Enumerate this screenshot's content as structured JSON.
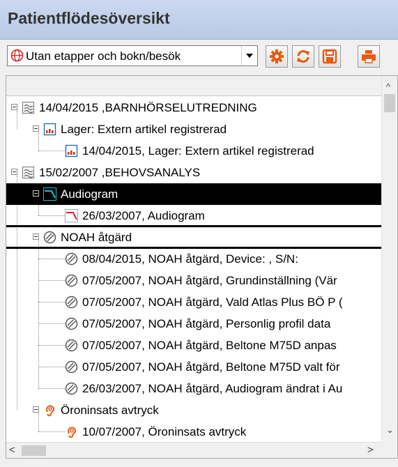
{
  "window": {
    "title": "Patientflödesöversikt"
  },
  "filter": {
    "selected": "Utan etapper och bokn/besök"
  },
  "toolbar": {
    "buttons": [
      {
        "name": "settings-button",
        "icon": "gear-icon",
        "color": "#e85a12"
      },
      {
        "name": "refresh-button",
        "icon": "refresh-icon",
        "color": "#e85a12"
      },
      {
        "name": "save-button",
        "icon": "save-icon",
        "color": "#e85a12"
      },
      {
        "name": "print-button",
        "icon": "print-icon",
        "color": "#e85a12"
      }
    ]
  },
  "tree": {
    "rows": [
      {
        "label": "14/04/2015 ,BARNHÖRSELUTREDNING",
        "icon": "referral-icon",
        "level": 0,
        "expander": true
      },
      {
        "label": "Lager: Extern artikel registrerad",
        "icon": "inventory-icon",
        "level": 1,
        "expander": true
      },
      {
        "label": "14/04/2015, Lager: Extern artikel registrerad",
        "icon": "inventory-icon",
        "level": 2,
        "expander": false
      },
      {
        "label": "15/02/2007 ,BEHOVSANALYS",
        "icon": "referral-icon",
        "level": 0,
        "expander": true
      },
      {
        "label": "Audiogram",
        "icon": "audiogram-icon",
        "level": 1,
        "expander": true,
        "selected": true
      },
      {
        "label": "26/03/2007, Audiogram",
        "icon": "audiogram-icon",
        "level": 2,
        "expander": false
      },
      {
        "label": "NOAH åtgärd",
        "icon": "noah-icon",
        "level": 1,
        "expander": true
      },
      {
        "label": "08/04/2015, NOAH åtgärd, Device: , S/N:",
        "icon": "noah-icon",
        "level": 2,
        "expander": false
      },
      {
        "label": "07/05/2007, NOAH åtgärd, Grundinställning (Vär",
        "icon": "noah-icon",
        "level": 2,
        "expander": false
      },
      {
        "label": "07/05/2007, NOAH åtgärd, Vald Atlas Plus BÖ P (",
        "icon": "noah-icon",
        "level": 2,
        "expander": false
      },
      {
        "label": "07/05/2007, NOAH åtgärd, Personlig profil data",
        "icon": "noah-icon",
        "level": 2,
        "expander": false
      },
      {
        "label": "07/05/2007, NOAH åtgärd, Beltone M75D anpas",
        "icon": "noah-icon",
        "level": 2,
        "expander": false
      },
      {
        "label": "07/05/2007, NOAH åtgärd, Beltone M75D valt för",
        "icon": "noah-icon",
        "level": 2,
        "expander": false
      },
      {
        "label": "26/03/2007, NOAH åtgärd, Audiogram ändrat i Au",
        "icon": "noah-icon",
        "level": 2,
        "expander": false
      },
      {
        "label": "Öroninsats avtryck",
        "icon": "ear-icon",
        "level": 1,
        "expander": true
      },
      {
        "label": "10/07/2007, Öroninsats avtryck",
        "icon": "ear-icon",
        "level": 2,
        "expander": false
      }
    ]
  },
  "colors": {
    "accent": "#e85a12",
    "selected_row": "#000000",
    "audiogram_line": "#e02020",
    "title_bar": "#c3d2ec"
  }
}
